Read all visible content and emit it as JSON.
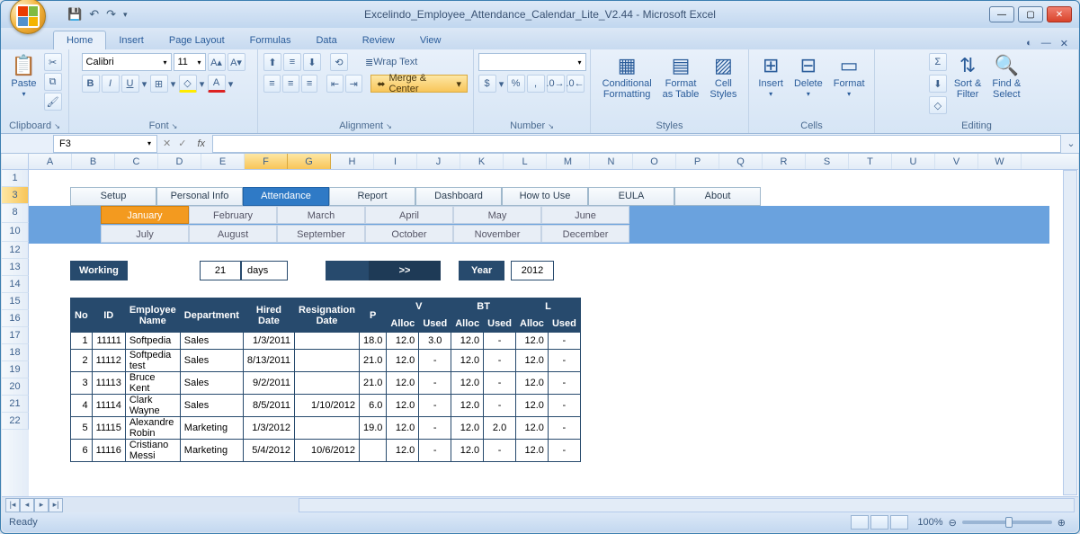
{
  "title": "Excelindo_Employee_Attendance_Calendar_Lite_V2.44 - Microsoft Excel",
  "tabs": [
    "Home",
    "Insert",
    "Page Layout",
    "Formulas",
    "Data",
    "Review",
    "View"
  ],
  "activeTab": "Home",
  "ribbon": {
    "clipboard": {
      "label": "Clipboard",
      "paste": "Paste"
    },
    "font": {
      "label": "Font",
      "name": "Calibri",
      "size": "11"
    },
    "alignment": {
      "label": "Alignment",
      "wrap": "Wrap Text",
      "merge": "Merge & Center"
    },
    "number": {
      "label": "Number"
    },
    "styles": {
      "label": "Styles",
      "cond": "Conditional\nFormatting",
      "fmt": "Format\nas Table",
      "cell": "Cell\nStyles"
    },
    "cells": {
      "label": "Cells",
      "ins": "Insert",
      "del": "Delete",
      "fmt": "Format"
    },
    "editing": {
      "label": "Editing",
      "sort": "Sort &\nFilter",
      "find": "Find &\nSelect"
    }
  },
  "namebox": "F3",
  "columns": [
    "A",
    "B",
    "C",
    "D",
    "E",
    "F",
    "G",
    "H",
    "I",
    "J",
    "K",
    "L",
    "M",
    "N",
    "O",
    "P",
    "Q",
    "R",
    "S",
    "T",
    "U",
    "V",
    "W"
  ],
  "selCols": [
    "F",
    "G"
  ],
  "rows": [
    "1",
    "3",
    "8",
    "10",
    "12",
    "13",
    "14",
    "15",
    "16",
    "17",
    "18",
    "19",
    "20",
    "21",
    "22"
  ],
  "selRow": "3",
  "nav": [
    "Setup",
    "Personal Info",
    "Attendance",
    "Report",
    "Dashboard",
    "How to Use",
    "EULA",
    "About"
  ],
  "navActive": "Attendance",
  "months1": [
    "January",
    "February",
    "March",
    "April",
    "May",
    "June"
  ],
  "months2": [
    "July",
    "August",
    "September",
    "October",
    "November",
    "December"
  ],
  "monthActive": "January",
  "wd": {
    "label": "Working Days",
    "val": "21",
    "unit": "days"
  },
  "arrow": ">>",
  "year": {
    "label": "Year",
    "val": "2012"
  },
  "thead": {
    "no": "No",
    "id": "ID",
    "name": "Employee Name",
    "dept": "Department",
    "hired": "Hired Date",
    "resig": "Resignation\nDate",
    "p": "P",
    "v": "V",
    "bt": "BT",
    "l": "L",
    "alloc": "Alloc",
    "used": "Used"
  },
  "rowsData": [
    {
      "no": "1",
      "id": "11111",
      "name": "Softpedia",
      "dept": "Sales",
      "hired": "1/3/2011",
      "resig": "",
      "p": "18.0",
      "v_a": "12.0",
      "v_u": "3.0",
      "bt_a": "12.0",
      "bt_u": "-",
      "l_a": "12.0",
      "l_u": "-"
    },
    {
      "no": "2",
      "id": "11112",
      "name": "Softpedia test",
      "dept": "Sales",
      "hired": "8/13/2011",
      "resig": "",
      "p": "21.0",
      "v_a": "12.0",
      "v_u": "-",
      "bt_a": "12.0",
      "bt_u": "-",
      "l_a": "12.0",
      "l_u": "-"
    },
    {
      "no": "3",
      "id": "11113",
      "name": "Bruce Kent",
      "dept": "Sales",
      "hired": "9/2/2011",
      "resig": "",
      "p": "21.0",
      "v_a": "12.0",
      "v_u": "-",
      "bt_a": "12.0",
      "bt_u": "-",
      "l_a": "12.0",
      "l_u": "-"
    },
    {
      "no": "4",
      "id": "11114",
      "name": "Clark Wayne",
      "dept": "Sales",
      "hired": "8/5/2011",
      "resig": "1/10/2012",
      "p": "6.0",
      "v_a": "12.0",
      "v_u": "-",
      "bt_a": "12.0",
      "bt_u": "-",
      "l_a": "12.0",
      "l_u": "-"
    },
    {
      "no": "5",
      "id": "11115",
      "name": "Alexandre Robin",
      "dept": "Marketing",
      "hired": "1/3/2012",
      "resig": "",
      "p": "19.0",
      "v_a": "12.0",
      "v_u": "-",
      "bt_a": "12.0",
      "bt_u": "2.0",
      "l_a": "12.0",
      "l_u": "-"
    },
    {
      "no": "6",
      "id": "11116",
      "name": "Cristiano Messi",
      "dept": "Marketing",
      "hired": "5/4/2012",
      "resig": "10/6/2012",
      "p": "",
      "v_a": "12.0",
      "v_u": "-",
      "bt_a": "12.0",
      "bt_u": "-",
      "l_a": "12.0",
      "l_u": "-"
    }
  ],
  "status": {
    "ready": "Ready",
    "zoom": "100%"
  }
}
